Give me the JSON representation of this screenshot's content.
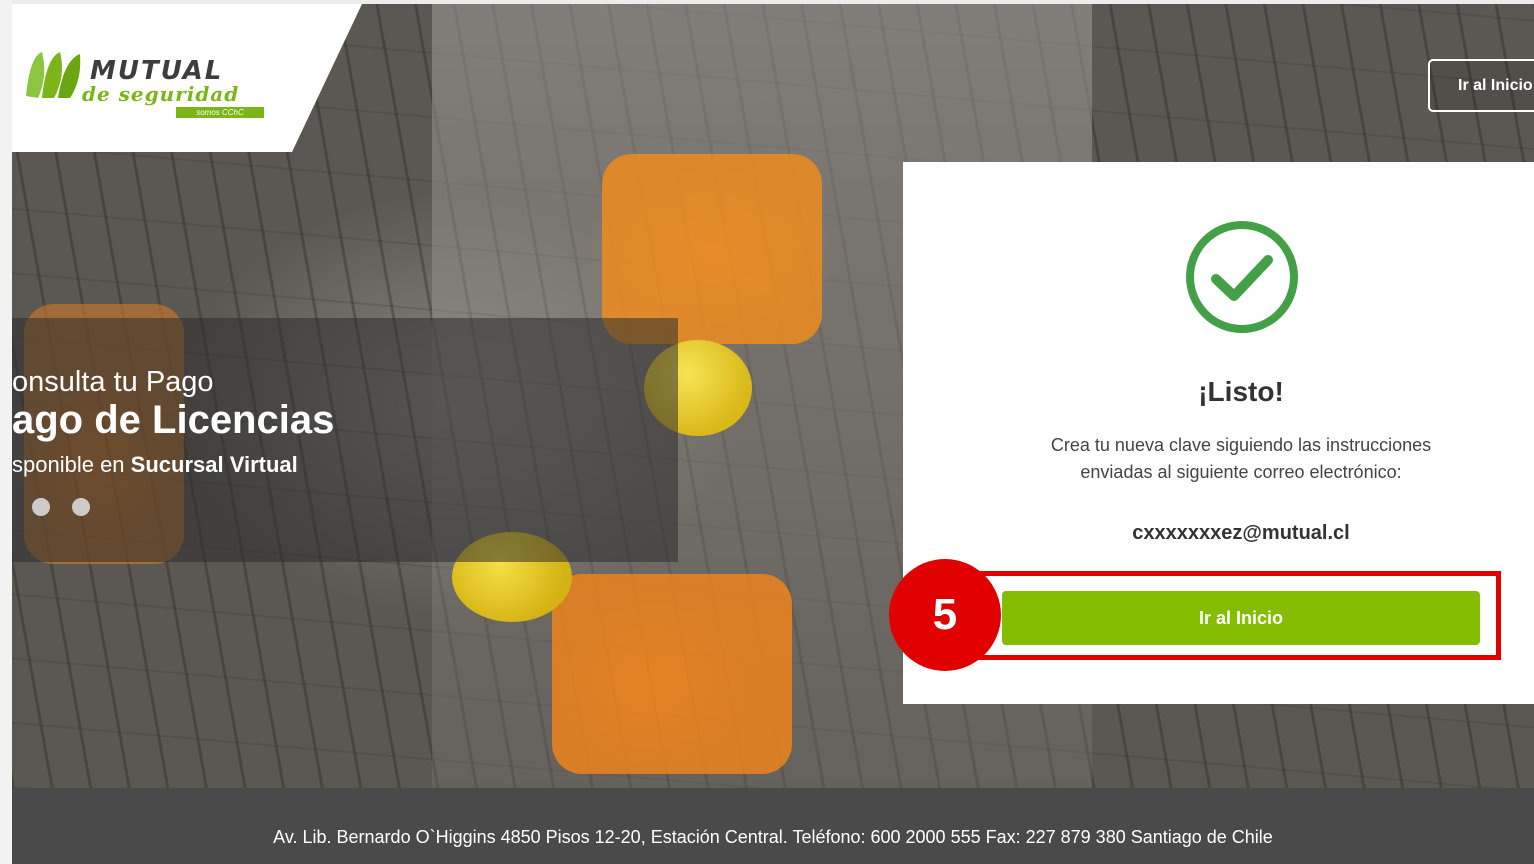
{
  "brand": {
    "name_main": "MUTUAL",
    "name_sub": "de seguridad",
    "tagline": "somos CChC",
    "green": "#84bd00"
  },
  "header": {
    "top_button_label": "Ir al Inicio"
  },
  "banner": {
    "line1": "onsulta tu Pago",
    "line2": "ago de Licencias",
    "line3_prefix": "sponible en ",
    "line3_bold": "Sucursal Virtual",
    "dots": 2
  },
  "card": {
    "icon": "check-circle-icon",
    "title": "¡Listo!",
    "message": "Crea tu nueva clave siguiendo las instrucciones enviadas al siguiente correo electrónico:",
    "email": "cxxxxxxxez@mutual.cl",
    "button_label": "Ir al Inicio"
  },
  "annotation": {
    "step_number": "5",
    "color": "#e00000"
  },
  "footer": {
    "address": "Av. Lib. Bernardo O`Higgins 4850 Pisos 12-20, Estación Central. Teléfono: 600 2000 555 Fax: 227 879 380 Santiago de Chile"
  }
}
